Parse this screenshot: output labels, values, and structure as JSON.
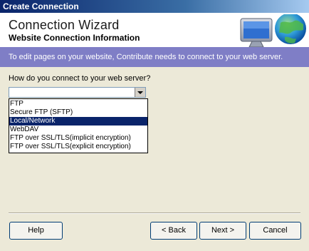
{
  "window": {
    "title": "Create Connection"
  },
  "header": {
    "title": "Connection Wizard",
    "subtitle": "Website Connection Information",
    "logo_icon": "monitor-globe-icon"
  },
  "banner": {
    "text": "To edit pages on your website, Contribute needs to connect to your web server."
  },
  "form": {
    "question": "How do you connect to your web server?",
    "selected_value": "",
    "options": [
      "FTP",
      "Secure FTP (SFTP)",
      "Local/Network",
      "WebDAV",
      "FTP over SSL/TLS(implicit encryption)",
      "FTP over SSL/TLS(explicit encryption)"
    ],
    "highlighted_index": 2
  },
  "buttons": {
    "help": "Help",
    "back": "< Back",
    "next": "Next >",
    "cancel": "Cancel"
  },
  "colors": {
    "banner_bg": "#7f7ec6",
    "selection_bg": "#0a246a",
    "dialog_bg": "#ece9d8"
  }
}
